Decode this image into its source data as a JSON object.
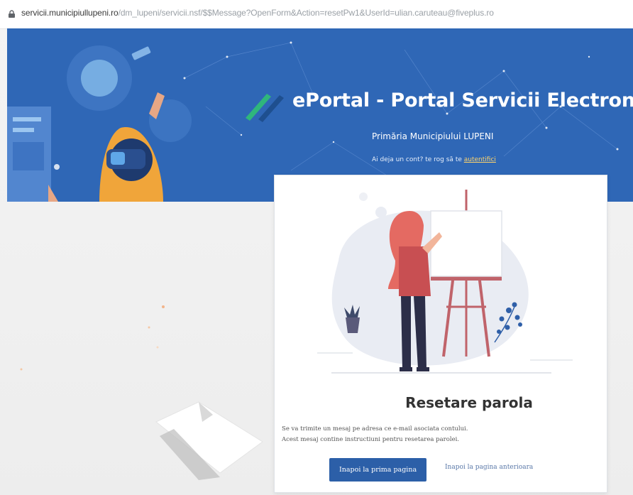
{
  "browser": {
    "url_host": "servicii.municipiullupeni.ro",
    "url_path": "/dm_lupeni/servicii.nsf/$$Message?OpenForm&Action=resetPw1&UserId=ulian.caruteau@fiveplus.ro"
  },
  "header": {
    "title": "ePortal - Portal Servicii Electronice",
    "subtitle": "Primăria Municipiului LUPENI",
    "account_prompt": "Ai deja un cont? te rog să te ",
    "account_link": "autentifici"
  },
  "card": {
    "heading": "Resetare parola",
    "message_line1": "Se va trimite un mesaj pe adresa ce e-mail asociata contului.",
    "message_line2": "Acest mesaj contine instructiuni pentru resetarea parolei.",
    "primary_button": "Inapoi la prima pagina",
    "secondary_link": "Inapoi la pagina anterioara"
  },
  "colors": {
    "banner": "#2f67b6",
    "primary_button": "#2c5fa8",
    "accent_green": "#2fb67c",
    "accent_link": "#ffd46b"
  },
  "icons": {
    "lock": "lock-icon",
    "brand": "brand-logo-icon"
  }
}
